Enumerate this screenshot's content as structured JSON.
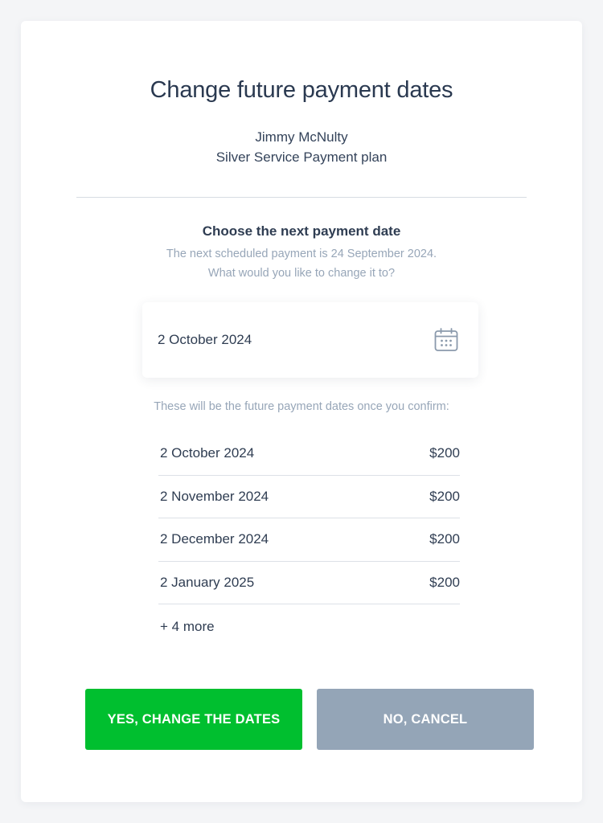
{
  "dialog": {
    "title": "Change future payment dates",
    "customer_name": "Jimmy McNulty",
    "plan_name": "Silver Service Payment plan"
  },
  "date_picker": {
    "heading": "Choose the next payment date",
    "help_line_1": "The next scheduled payment is 24 September 2024.",
    "help_line_2": "What would you like to change it to?",
    "selected_date": "2 October 2024",
    "icon": "calendar-icon"
  },
  "schedule": {
    "note": "These will be the future payment dates once you confirm:",
    "rows": [
      {
        "date": "2 October 2024",
        "amount": "$200"
      },
      {
        "date": "2 November 2024",
        "amount": "$200"
      },
      {
        "date": "2 December 2024",
        "amount": "$200"
      },
      {
        "date": "2 January 2025",
        "amount": "$200"
      }
    ],
    "more_label": "+ 4 more"
  },
  "actions": {
    "confirm_label": "YES, CHANGE THE DATES",
    "cancel_label": "NO, CANCEL"
  },
  "colors": {
    "confirm_button": "#00bf2f",
    "cancel_button": "#94a5b7",
    "heading_text": "#2a3950",
    "muted_text": "#97a6b8"
  }
}
